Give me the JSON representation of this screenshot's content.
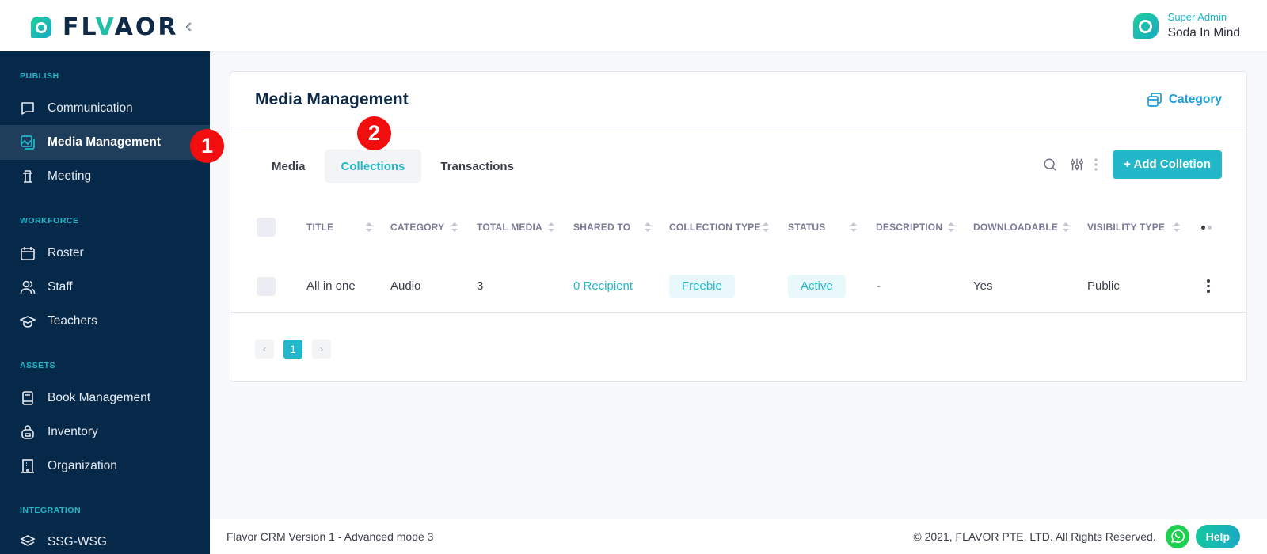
{
  "brand": {
    "name_prefix": "FL",
    "name_accent": "V",
    "name_mid": "A",
    "name_suffix": "OR",
    "collapse_icon": "double-chevron-left-icon"
  },
  "user": {
    "role": "Super Admin",
    "name": "Soda In Mind"
  },
  "sidebar": {
    "sections": [
      {
        "label": "PUBLISH",
        "items": [
          {
            "label": "Communication",
            "icon": "chat-icon"
          },
          {
            "label": "Media Management",
            "icon": "media-icon",
            "active": true
          },
          {
            "label": "Meeting",
            "icon": "podium-icon"
          }
        ]
      },
      {
        "label": "WORKFORCE",
        "items": [
          {
            "label": "Roster",
            "icon": "calendar-icon"
          },
          {
            "label": "Staff",
            "icon": "users-icon"
          },
          {
            "label": "Teachers",
            "icon": "graduation-cap-icon"
          }
        ]
      },
      {
        "label": "ASSETS",
        "items": [
          {
            "label": "Book Management",
            "icon": "book-icon"
          },
          {
            "label": "Inventory",
            "icon": "backpack-icon"
          },
          {
            "label": "Organization",
            "icon": "building-icon"
          }
        ]
      },
      {
        "label": "INTEGRATION",
        "items": [
          {
            "label": "SSG-WSG",
            "icon": "layers-icon"
          }
        ]
      }
    ]
  },
  "annotations": {
    "step1": "1",
    "step2": "2"
  },
  "page": {
    "title": "Media Management",
    "category_link": "Category",
    "tabs": [
      {
        "label": "Media"
      },
      {
        "label": "Collections",
        "active": true
      },
      {
        "label": "Transactions"
      }
    ],
    "add_button": "+ Add Colletion"
  },
  "table": {
    "columns": [
      "TITLE",
      "CATEGORY",
      "TOTAL MEDIA",
      "SHARED TO",
      "COLLECTION TYPE",
      "STATUS",
      "DESCRIPTION",
      "DOWNLOADABLE",
      "VISIBILITY TYPE"
    ],
    "rows": [
      {
        "title": "All in one",
        "category": "Audio",
        "total_media": "3",
        "shared_to": "0 Recipient",
        "collection_type": "Freebie",
        "status": "Active",
        "description": "-",
        "downloadable": "Yes",
        "visibility_type": "Public"
      }
    ]
  },
  "pagination": {
    "prev": "‹",
    "current": "1",
    "next": "›"
  },
  "footer": {
    "version": "Flavor CRM Version 1 - Advanced mode 3",
    "copyright": "© 2021, FLAVOR PTE. LTD. All Rights Reserved.",
    "help": "Help"
  },
  "colors": {
    "accent": "#22b8ca",
    "sidebar_bg": "#06294a",
    "sidebar_active": "#1f3e5c",
    "title": "#0e2a47",
    "badge": "#f20e0e",
    "link_blue": "#1a9ed8"
  }
}
